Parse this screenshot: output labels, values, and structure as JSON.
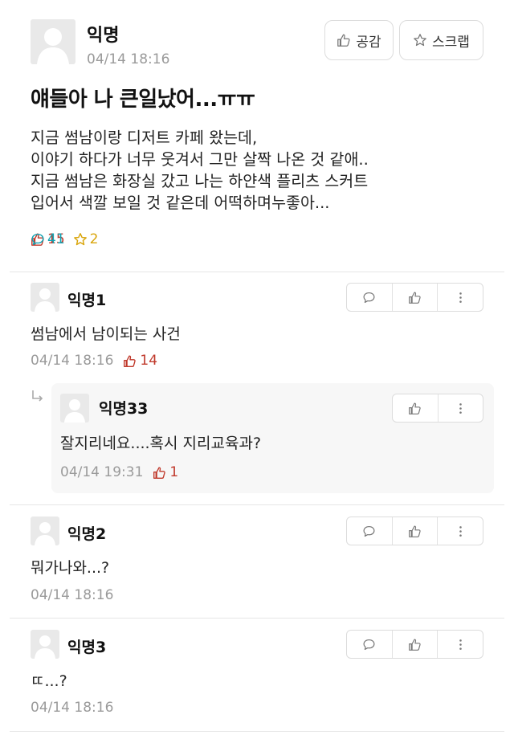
{
  "post": {
    "author": "익명",
    "time": "04/14 18:16",
    "like_button_label": "공감",
    "scrap_button_label": "스크랩",
    "title": "얘들아 나 큰일났어...ㅠㅠ",
    "body_lines": [
      "지금 썸남이랑 디저트 카페 왔는데,",
      "이야기 하다가 너무 웃겨서 그만 살짝 나온 것 같애..",
      "지금 썸남은 화장실 갔고 나는 하얀색 플리츠 스커트",
      "입어서 색깔 보일 것 같은데 어떡하며누좋아..."
    ],
    "stats": {
      "likes": "15",
      "comments": "41",
      "scraps": "2"
    }
  },
  "comments": [
    {
      "author": "익명1",
      "text": "썸남에서 남이되는 사건",
      "time": "04/14 18:16",
      "votes": "14"
    },
    {
      "author": "익명2",
      "text": "뭐가나와...?",
      "time": "04/14 18:16",
      "votes": ""
    },
    {
      "author": "익명3",
      "text": "ㄸ...?",
      "time": "04/14 18:16",
      "votes": ""
    }
  ],
  "reply": {
    "author": "익명33",
    "text": "잘지리네요....혹시 지리교육과?",
    "time": "04/14 19:31",
    "votes": "1"
  },
  "icons": {
    "avatar": "default-avatar-icon",
    "like": "thumbs-up-icon",
    "comment": "speech-bubble-icon",
    "scrap": "star-icon",
    "more": "vertical-dots-icon",
    "reply": "reply-arrow-icon"
  },
  "colors": {
    "like": "#c0392b",
    "comment": "#12a3b3",
    "scrap": "#d9a50b",
    "meta": "#9a9a9a"
  }
}
